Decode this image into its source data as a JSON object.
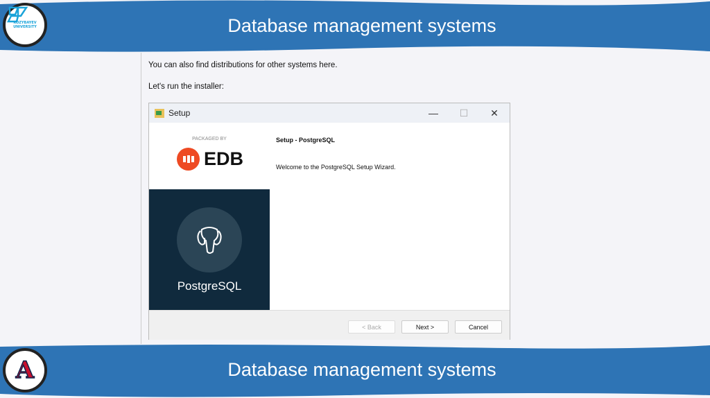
{
  "header": {
    "title": "Database management systems",
    "logo_text": "KOZYBAYEV UNIVERSITY"
  },
  "footer": {
    "title": "Database management systems",
    "logo_letter": "A"
  },
  "content": {
    "line1": "You can also find distributions for other systems here.",
    "line2": "Let's run the installer:"
  },
  "dialog": {
    "title": "Setup",
    "packaged_by": "PACKAGED BY",
    "vendor": "EDB",
    "product": "PostgreSQL",
    "heading": "Setup - PostgreSQL",
    "welcome": "Welcome to the PostgreSQL Setup Wizard.",
    "buttons": {
      "back": "< Back",
      "next": "Next >",
      "cancel": "Cancel"
    },
    "controls": {
      "minimize": "—",
      "maximize": "☐",
      "close": "✕"
    }
  },
  "colors": {
    "band": "#2e74b5",
    "edb": "#ee4a23",
    "pg_panel": "#102a3d"
  }
}
